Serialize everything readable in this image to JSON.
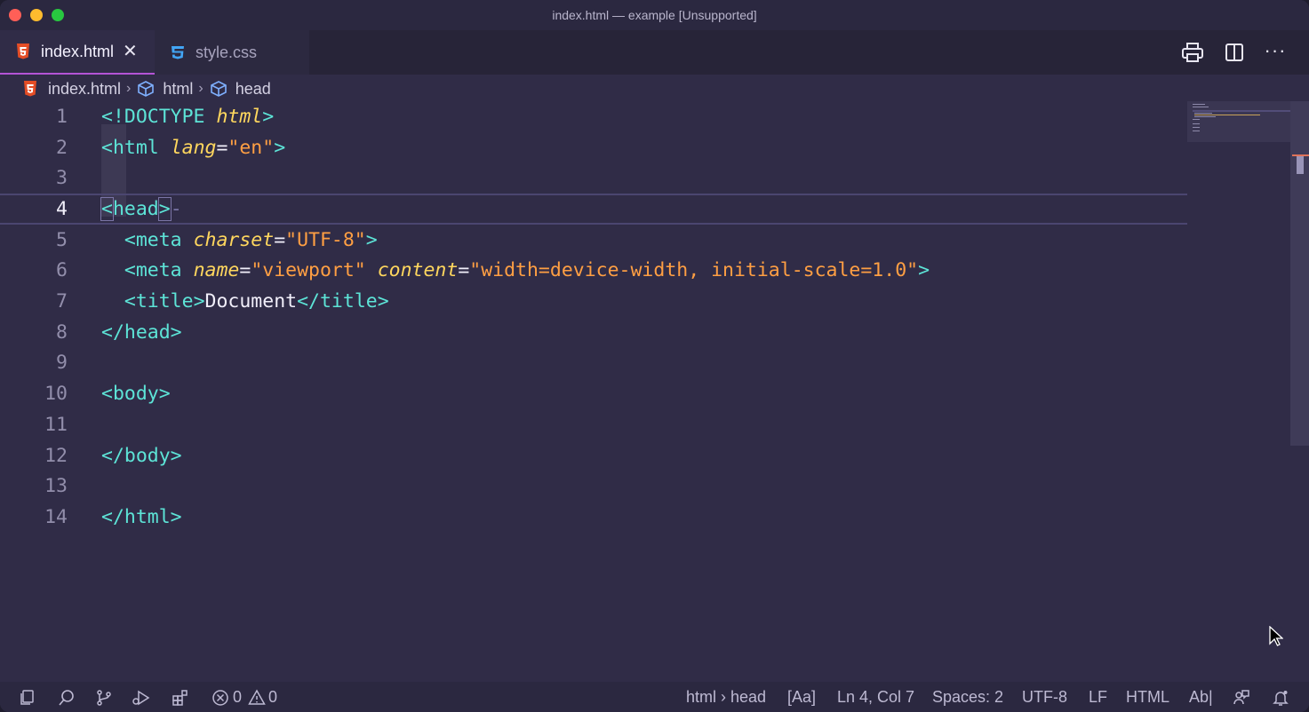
{
  "window": {
    "title": "index.html — example [Unsupported]"
  },
  "tabs": [
    {
      "label": "index.html",
      "icon": "html5-icon",
      "active": true
    },
    {
      "label": "style.css",
      "icon": "css3-icon",
      "active": false
    }
  ],
  "toolbar": {
    "icons": [
      "print-icon",
      "split-editor-icon",
      "more-actions-icon"
    ]
  },
  "breadcrumb": {
    "file": "index.html",
    "items": [
      "html",
      "head"
    ]
  },
  "editor": {
    "current_line": 4,
    "lines": [
      {
        "n": "1",
        "tokens": [
          [
            "t-punc",
            "<!DOCTYPE "
          ],
          [
            "t-attr",
            "html"
          ],
          [
            "t-punc",
            ">"
          ]
        ]
      },
      {
        "n": "2",
        "tokens": [
          [
            "t-punc",
            "<"
          ],
          [
            "t-tag",
            "html "
          ],
          [
            "t-attr",
            "lang"
          ],
          [
            "t-eq",
            "="
          ],
          [
            "t-str",
            "\"en\""
          ],
          [
            "t-punc",
            ">"
          ]
        ]
      },
      {
        "n": "3",
        "tokens": []
      },
      {
        "n": "4",
        "tokens": [
          [
            "t-punc",
            "<"
          ],
          [
            "t-tag",
            "head"
          ],
          [
            "t-punc",
            ">"
          ]
        ]
      },
      {
        "n": "5",
        "tokens": [
          [
            "t-text",
            "  "
          ],
          [
            "t-punc",
            "<"
          ],
          [
            "t-tag",
            "meta "
          ],
          [
            "t-attr",
            "charset"
          ],
          [
            "t-eq",
            "="
          ],
          [
            "t-str",
            "\"UTF-8\""
          ],
          [
            "t-punc",
            ">"
          ]
        ]
      },
      {
        "n": "6",
        "tokens": [
          [
            "t-text",
            "  "
          ],
          [
            "t-punc",
            "<"
          ],
          [
            "t-tag",
            "meta "
          ],
          [
            "t-attr",
            "name"
          ],
          [
            "t-eq",
            "="
          ],
          [
            "t-str",
            "\"viewport\" "
          ],
          [
            "t-attr",
            "content"
          ],
          [
            "t-eq",
            "="
          ],
          [
            "t-str",
            "\"width=device-width, initial-scale=1.0\""
          ],
          [
            "t-punc",
            ">"
          ]
        ]
      },
      {
        "n": "7",
        "tokens": [
          [
            "t-text",
            "  "
          ],
          [
            "t-punc",
            "<"
          ],
          [
            "t-tag",
            "title"
          ],
          [
            "t-punc",
            ">"
          ],
          [
            "t-text",
            "Document"
          ],
          [
            "t-punc",
            "</"
          ],
          [
            "t-tag",
            "title"
          ],
          [
            "t-punc",
            ">"
          ]
        ]
      },
      {
        "n": "8",
        "tokens": [
          [
            "t-punc",
            "</"
          ],
          [
            "t-tag",
            "head"
          ],
          [
            "t-punc",
            ">"
          ]
        ]
      },
      {
        "n": "9",
        "tokens": []
      },
      {
        "n": "10",
        "tokens": [
          [
            "t-punc",
            "<"
          ],
          [
            "t-tag",
            "body"
          ],
          [
            "t-punc",
            ">"
          ]
        ]
      },
      {
        "n": "11",
        "tokens": []
      },
      {
        "n": "12",
        "tokens": [
          [
            "t-punc",
            "</"
          ],
          [
            "t-tag",
            "body"
          ],
          [
            "t-punc",
            ">"
          ]
        ]
      },
      {
        "n": "13",
        "tokens": []
      },
      {
        "n": "14",
        "tokens": [
          [
            "t-punc",
            "</"
          ],
          [
            "t-tag",
            "html"
          ],
          [
            "t-punc",
            ">"
          ]
        ]
      }
    ]
  },
  "statusbar": {
    "errors": "0",
    "warnings": "0",
    "breadcrumb": "html › head",
    "case_toggle": "[Aa]",
    "cursor_position": "Ln 4, Col 7",
    "indentation": "Spaces: 2",
    "encoding": "UTF-8",
    "line_ending": "LF",
    "language": "HTML",
    "spell": "Ab|"
  },
  "colors": {
    "background": "#302c47",
    "tag": "#5de4d7",
    "attribute": "#ffd75e",
    "string": "#ff9f43",
    "active_tab_accent": "#b454d6"
  }
}
